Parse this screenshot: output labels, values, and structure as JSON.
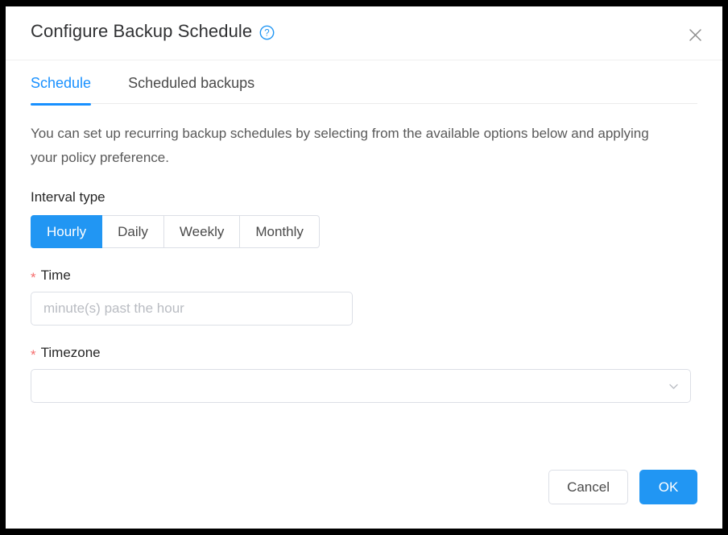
{
  "dialog": {
    "title": "Configure Backup Schedule",
    "help_icon": "help-circle-icon",
    "close_icon": "close-icon",
    "accent_color": "#2196f3",
    "required_color": "#f56c6c"
  },
  "tabs": [
    {
      "label": "Schedule",
      "active": true
    },
    {
      "label": "Scheduled backups",
      "active": false
    }
  ],
  "body": {
    "description": "You can set up recurring backup schedules by selecting from the available options below and applying your policy preference."
  },
  "interval": {
    "label": "Interval type",
    "options": [
      {
        "label": "Hourly",
        "active": true
      },
      {
        "label": "Daily",
        "active": false
      },
      {
        "label": "Weekly",
        "active": false
      },
      {
        "label": "Monthly",
        "active": false
      }
    ]
  },
  "time": {
    "label": "Time",
    "required_mark": "*",
    "value": "",
    "placeholder": "minute(s) past the hour"
  },
  "timezone": {
    "label": "Timezone",
    "required_mark": "*",
    "value": "",
    "dropdown_icon": "chevron-down-icon"
  },
  "footer": {
    "cancel_label": "Cancel",
    "ok_label": "OK"
  }
}
